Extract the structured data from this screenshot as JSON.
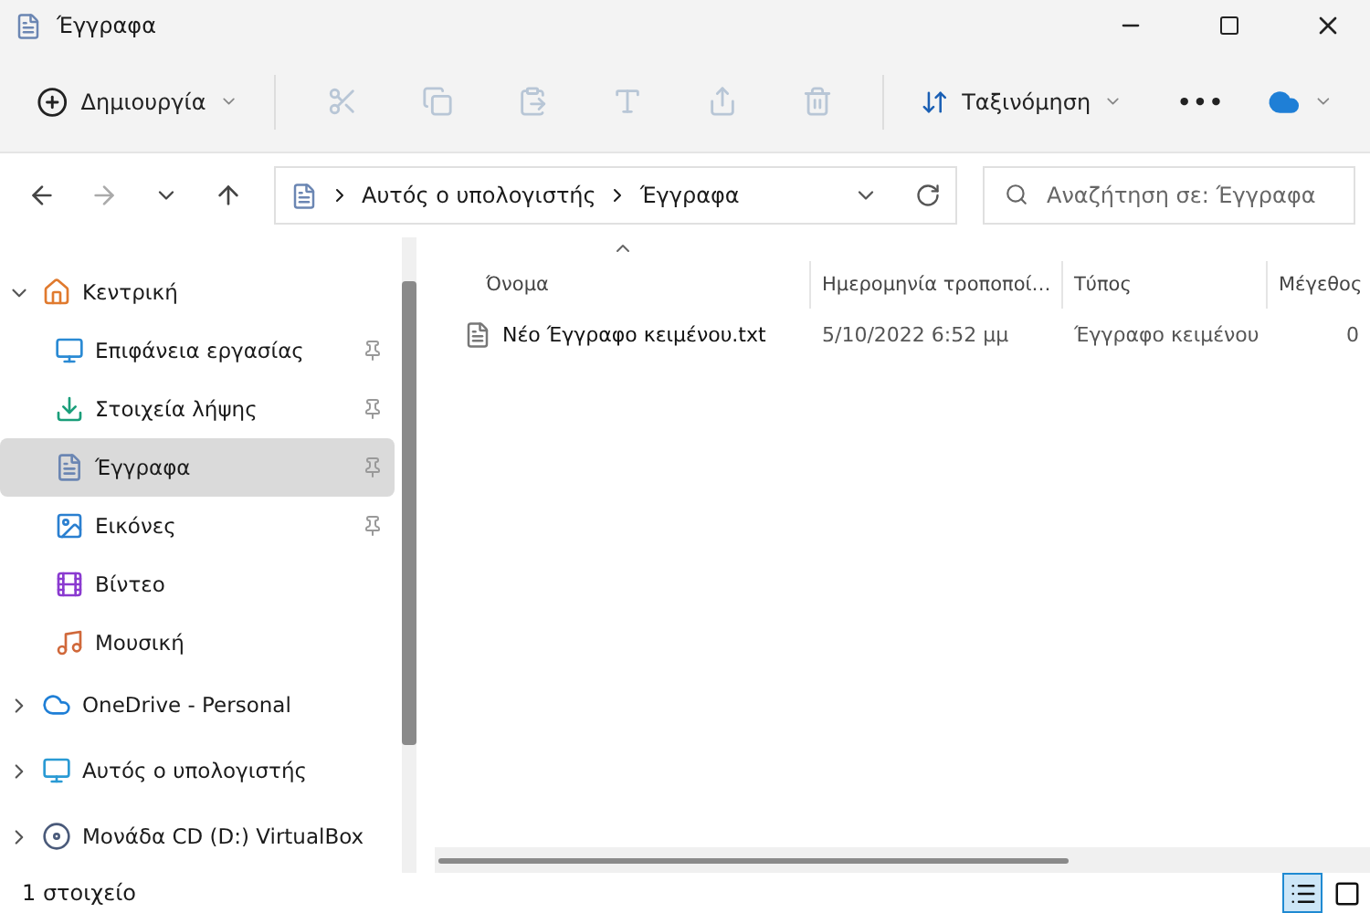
{
  "window": {
    "title": "Έγγραφα"
  },
  "toolbar": {
    "new_label": "Δημιουργία",
    "actions": [
      {
        "kind": "cut",
        "disabled": true
      },
      {
        "kind": "copy",
        "disabled": true
      },
      {
        "kind": "paste",
        "disabled": true
      },
      {
        "kind": "rename",
        "disabled": true
      },
      {
        "kind": "share",
        "disabled": true
      },
      {
        "kind": "delete",
        "disabled": true
      }
    ],
    "sort_label": "Ταξινόμηση",
    "more_label": "•••"
  },
  "address": {
    "path": [
      "Αυτός ο υπολογιστής",
      "Έγγραφα"
    ],
    "search_placeholder": "Αναζήτηση σε: Έγγραφα"
  },
  "sidebar": {
    "items": [
      {
        "kind": "home",
        "label": "Κεντρική",
        "expanded": true,
        "selected": false,
        "children": [
          {
            "kind": "desktop",
            "label": "Επιφάνεια εργασίας",
            "pinned": true,
            "selected": false
          },
          {
            "kind": "downloads",
            "label": "Στοιχεία λήψης",
            "pinned": true,
            "selected": false
          },
          {
            "kind": "documents",
            "label": "Έγγραφα",
            "pinned": true,
            "selected": true
          },
          {
            "kind": "pictures",
            "label": "Εικόνες",
            "pinned": true,
            "selected": false
          },
          {
            "kind": "videos",
            "label": "Βίντεο",
            "pinned": false,
            "selected": false
          },
          {
            "kind": "music",
            "label": "Μουσική",
            "pinned": false,
            "selected": false
          }
        ]
      },
      {
        "kind": "onedrive",
        "label": "OneDrive - Personal",
        "expanded": false,
        "selected": false
      },
      {
        "kind": "pc",
        "label": "Αυτός ο υπολογιστής",
        "expanded": false,
        "selected": false
      },
      {
        "kind": "cd",
        "label": "Μονάδα CD (D:) VirtualBox",
        "expanded": false,
        "selected": false
      }
    ]
  },
  "table": {
    "columns": [
      {
        "label": "Όνομα",
        "sorted": true
      },
      {
        "label": "Ημερομηνία τροποποί…",
        "sorted": false
      },
      {
        "label": "Τύπος",
        "sorted": false
      },
      {
        "label": "Μέγεθος",
        "sorted": false
      }
    ],
    "rows": [
      {
        "name": "Νέο Έγγραφο κειμένου.txt",
        "date": "5/10/2022 6:52 μμ",
        "type": "Έγγραφο κειμένου",
        "size": "0"
      }
    ]
  },
  "status_bar": {
    "text": "1 στοιχείο",
    "views": [
      {
        "kind": "details",
        "selected": true
      },
      {
        "kind": "tiles",
        "selected": false
      }
    ]
  }
}
